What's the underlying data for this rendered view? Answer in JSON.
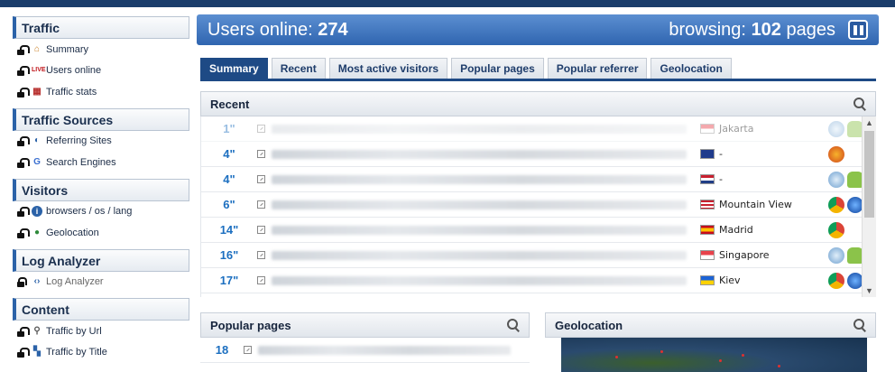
{
  "header": {
    "users_online_label": "Users online:",
    "users_online_count": "274",
    "browsing_label": "browsing:",
    "browsing_count": "102",
    "browsing_unit": "pages"
  },
  "sidebar": {
    "sections": [
      {
        "title": "Traffic",
        "items": [
          {
            "label": "Summary",
            "icon": "home-icon"
          },
          {
            "label": "Users online",
            "icon": "live-icon"
          },
          {
            "label": "Traffic stats",
            "icon": "calendar-icon"
          }
        ]
      },
      {
        "title": "Traffic Sources",
        "items": [
          {
            "label": "Referring Sites",
            "icon": "referrer-icon"
          },
          {
            "label": "Search Engines",
            "icon": "google-icon"
          }
        ]
      },
      {
        "title": "Visitors",
        "items": [
          {
            "label": "browsers / os / lang",
            "icon": "info-icon"
          },
          {
            "label": "Geolocation",
            "icon": "globe-icon"
          }
        ]
      },
      {
        "title": "Log Analyzer",
        "items": [
          {
            "label": "Log Analyzer",
            "icon": "code-icon"
          }
        ]
      },
      {
        "title": "Content",
        "items": [
          {
            "label": "Traffic by Url",
            "icon": "link-icon"
          },
          {
            "label": "Traffic by Title",
            "icon": "title-icon"
          }
        ]
      }
    ]
  },
  "tabs": [
    "Summary",
    "Recent",
    "Most active visitors",
    "Popular pages",
    "Popular referrer",
    "Geolocation"
  ],
  "recent": {
    "title": "Recent",
    "rows": [
      {
        "time": "1\"",
        "city": "Jakarta",
        "flag": "indonesia-flag",
        "icons": [
          "os-icon",
          "android-icon"
        ]
      },
      {
        "time": "4\"",
        "city": "-",
        "flag": "australia-flag",
        "icons": [
          "firefox-icon"
        ]
      },
      {
        "time": "4\"",
        "city": "-",
        "flag": "netherlands-flag",
        "icons": [
          "os-icon",
          "android-icon"
        ]
      },
      {
        "time": "6\"",
        "city": "Mountain View",
        "flag": "usa-flag",
        "icons": [
          "chrome-icon",
          "windows-icon"
        ]
      },
      {
        "time": "14\"",
        "city": "Madrid",
        "flag": "spain-flag",
        "icons": [
          "chrome-icon"
        ]
      },
      {
        "time": "16\"",
        "city": "Singapore",
        "flag": "singapore-flag",
        "icons": [
          "os-icon",
          "android-icon"
        ]
      },
      {
        "time": "17\"",
        "city": "Kiev",
        "flag": "ukraine-flag",
        "icons": [
          "chrome-icon",
          "windows-icon"
        ]
      }
    ]
  },
  "popular": {
    "title": "Popular pages",
    "rows": [
      {
        "count": "18"
      }
    ]
  },
  "geolocation": {
    "title": "Geolocation"
  },
  "colors": {
    "accent": "#2f65b0",
    "tab_active": "#1e4a85",
    "time_text": "#1c6fc0"
  }
}
